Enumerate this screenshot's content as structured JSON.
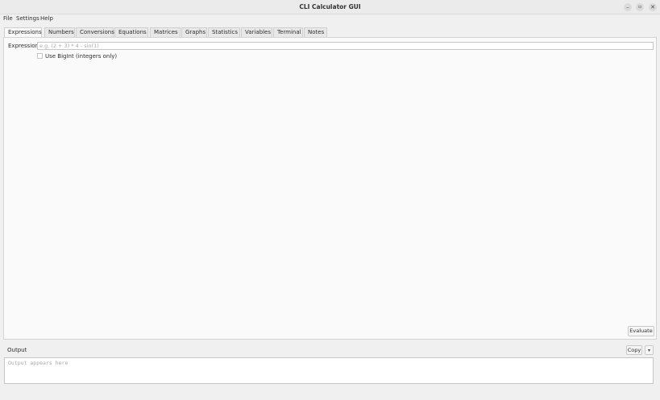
{
  "window": {
    "title": "CLI Calculator GUI",
    "min_glyph": "–",
    "max_glyph": "▫",
    "close_glyph": "✕"
  },
  "menu": {
    "file": "File",
    "settings": "Settings",
    "help": "Help"
  },
  "tabs": [
    {
      "label": "Expressions",
      "active": true
    },
    {
      "label": "Numbers"
    },
    {
      "label": "Conversions"
    },
    {
      "label": "Equations"
    },
    {
      "label": "Matrices"
    },
    {
      "label": "Graphs"
    },
    {
      "label": "Statistics"
    },
    {
      "label": "Variables"
    },
    {
      "label": "Terminal"
    },
    {
      "label": "Notes"
    }
  ],
  "expressions": {
    "label": "Expression",
    "value": "",
    "placeholder": "e.g. (2 + 3) * 4 - sin(1)",
    "bigint_label": "Use BigInt (integers only)",
    "bigint_checked": false,
    "evaluate_label": "Evaluate"
  },
  "output": {
    "label": "Output",
    "copy_label": "Copy",
    "copy_menu_glyph": "▾",
    "placeholder": "Output appears here"
  }
}
